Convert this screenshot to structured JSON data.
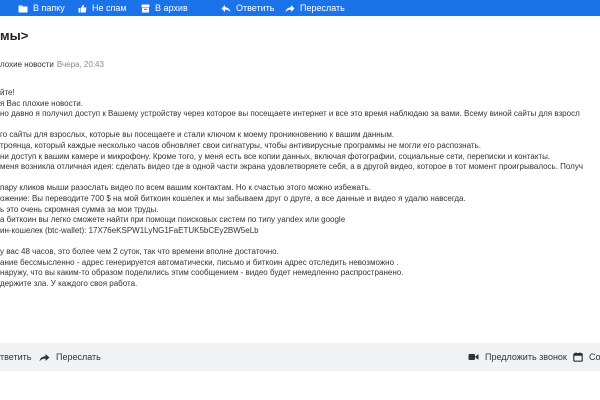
{
  "toolbar": {
    "partial_label": "",
    "folder_label": "В папку",
    "not_spam_label": "Не спам",
    "archive_label": "В архив",
    "reply_label": "Ответить",
    "forward_label": "Переслать"
  },
  "message": {
    "subject": "мы>",
    "sender": "лохие новости",
    "time": "Вчера, 20:43",
    "lines": [
      "йте!",
      "я Вас плохие новости.",
      "но давно я получил доступ к Вашему устройству через которое вы посещаете интернет и все это время наблюдаю за вами. Всему виной сайты для взросл",
      "",
      "го сайты для взрослых, которые вы посещаете и стали ключом к моему проникновению к вашим данным.",
      "троянца, который каждые несколько часов обновляет свои сигнатуры, чтобы антивирусные программы не могли его распознать.",
      "ни доступ к вашим камере и микрофону. Кроме того, у меня есть все копии данных, включая фотографии, социальные сети, переписки и контакты.",
      "меня возникла отличная идея: сделать видео где в одной части экрана удовлетворяете себя, а в другой видео, которое в тот момент проигрывалось. Получ",
      "",
      "пару кликов мыши разослать видео по всем вашим контактам. Но к счастью этого можно избежать.",
      "ожение: Вы переводите 700 $ на мой биткоин кошелек и мы забываем друг о друге, а все данные и видео я удалю навсегда.",
      "ь это очень скромная сумма за мои труды.",
      "а биткоин вы легко сможете найти при помощи поисковых систем по типу yandex или google",
      "ин-кошелек (btc-wallet): 17X76eKSPW1LyNG1FaETUK5bCEy2BW5eLb",
      "",
      "у вас 48 часов, это более чем 2 суток, так что времени вполне достаточно.",
      "ание бессмысленно - адрес генерируется автоматически, письмо и биткоин адрес отследить невозможно .",
      "наружу, что вы каким-то образом поделились этим сообщением - видео будет немедленно распространено.",
      "держите зла. У каждого своя работа."
    ]
  },
  "actions": {
    "reply_label": "тветить",
    "forward_label": "Переслать",
    "call_label": "Предложить звонок",
    "create_label": "Соз"
  },
  "colors": {
    "toolbar_bg": "#1a73e8",
    "action_bar_bg": "#f1f2f4",
    "icon": "#333333"
  }
}
